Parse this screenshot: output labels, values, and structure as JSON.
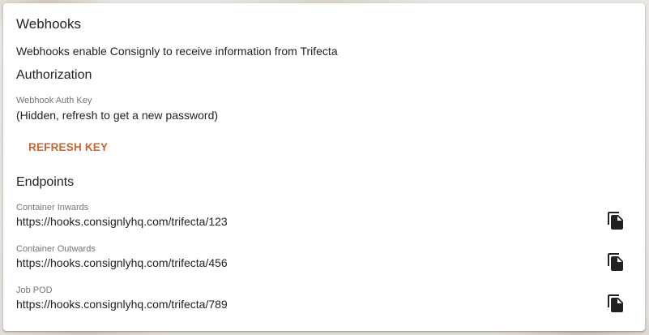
{
  "webhooks": {
    "title": "Webhooks",
    "description": "Webhooks enable Consignly to receive information from Trifecta"
  },
  "authorization": {
    "heading": "Authorization",
    "auth_key_label": "Webhook Auth Key",
    "auth_key_value": "(Hidden, refresh to get a new password)",
    "refresh_label": "REFRESH KEY"
  },
  "endpoints": {
    "heading": "Endpoints",
    "items": [
      {
        "label": "Container Inwards",
        "url": "https://hooks.consignlyhq.com/trifecta/123"
      },
      {
        "label": "Container Outwards",
        "url": "https://hooks.consignlyhq.com/trifecta/456"
      },
      {
        "label": "Job POD",
        "url": "https://hooks.consignlyhq.com/trifecta/789"
      }
    ],
    "copy_icon": "copy-icon"
  },
  "colors": {
    "accent": "#d0612a",
    "text": "#222222",
    "label": "#757575"
  }
}
